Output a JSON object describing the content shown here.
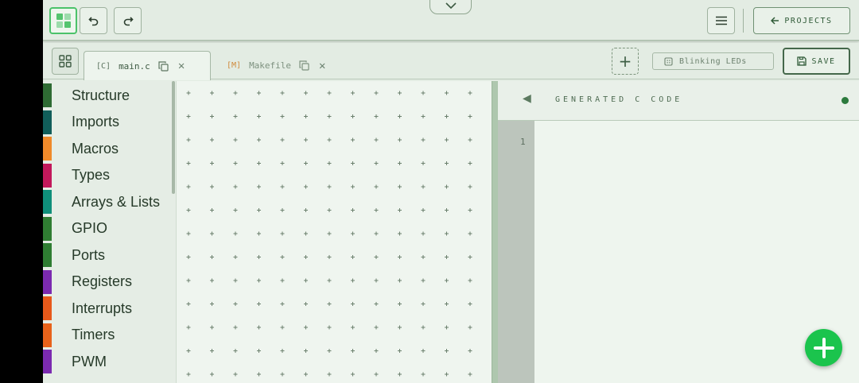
{
  "toolbar": {
    "logo_icon": "blocks-logo-icon",
    "undo_icon": "undo-icon",
    "redo_icon": "redo-icon",
    "collapse_icon": "chevron-down-icon",
    "menu_icon": "hamburger-menu-icon",
    "projects_label": "PROJECTS",
    "projects_icon": "arrow-left-icon"
  },
  "tabs": {
    "items": [
      {
        "prefix": "[C]",
        "name": "main.c",
        "active": true
      },
      {
        "prefix": "[M]",
        "name": "Makefile",
        "active": false
      }
    ],
    "add_label": "+",
    "project_name": "Blinking LEDs",
    "save_label": "SAVE"
  },
  "categories": [
    {
      "label": "Structure",
      "color": "#2e6b33"
    },
    {
      "label": "Imports",
      "color": "#115e5a"
    },
    {
      "label": "Macros",
      "color": "#f08a2a"
    },
    {
      "label": "Types",
      "color": "#c2185b"
    },
    {
      "label": "Arrays & Lists",
      "color": "#0f8f7a"
    },
    {
      "label": "GPIO",
      "color": "#2f7d32"
    },
    {
      "label": "Ports",
      "color": "#2e7d32"
    },
    {
      "label": "Registers",
      "color": "#7b2ab0"
    },
    {
      "label": "Interrupts",
      "color": "#e8591a"
    },
    {
      "label": "Timers",
      "color": "#e8621a"
    },
    {
      "label": "PWM",
      "color": "#7b2ab0"
    }
  ],
  "code_panel": {
    "title": "GENERATED C CODE",
    "line_numbers": [
      "1"
    ]
  },
  "fab": {
    "icon": "plus-icon",
    "color": "#1bc44d"
  }
}
